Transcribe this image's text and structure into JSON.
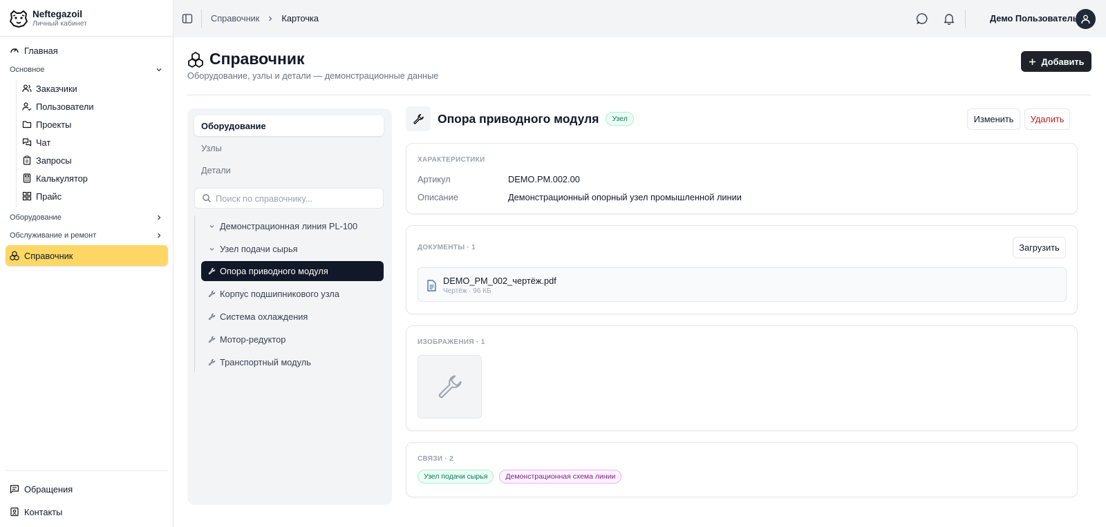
{
  "brand": {
    "name": "Neftegazoil",
    "subtitle": "Личный кабинет"
  },
  "sidebar": {
    "home": "Главная",
    "sections": {
      "main": "Основное",
      "equipment": "Оборудование",
      "service": "Обслуживание и ремонт"
    },
    "sub_items": [
      {
        "label": "Заказчики",
        "icon": "users-icon"
      },
      {
        "label": "Пользователи",
        "icon": "user-check-icon"
      },
      {
        "label": "Проекты",
        "icon": "folder-icon"
      },
      {
        "label": "Чат",
        "icon": "messages-icon"
      },
      {
        "label": "Запросы",
        "icon": "clipboard-icon"
      },
      {
        "label": "Калькулятор",
        "icon": "calculator-icon"
      },
      {
        "label": "Прайс",
        "icon": "grid-icon"
      }
    ],
    "active": "Справочник",
    "bottom": {
      "requests": "Обращения",
      "contacts": "Контакты"
    }
  },
  "header": {
    "breadcrumbs": [
      "Справочник",
      "Карточка"
    ],
    "user_name": "Демо Пользователь"
  },
  "page": {
    "title": "Справочник",
    "subtitle": "Оборудование, узлы и детали — демонстрационные данные",
    "add_label": "Добавить"
  },
  "catalog": {
    "tabs": [
      "Оборудование",
      "Узлы",
      "Детали"
    ],
    "active_tab": "Оборудование",
    "search_placeholder": "Поиск по справочнику...",
    "tree": [
      {
        "label": "Демонстрационная линия PL-100",
        "icon": "chevron-down-icon",
        "active": false
      },
      {
        "label": "Узел подачи сырья",
        "icon": "chevron-down-icon",
        "active": false
      },
      {
        "label": "Опора приводного модуля",
        "icon": "wrench-icon",
        "active": true
      },
      {
        "label": "Корпус подшипникового узла",
        "icon": "wrench-icon",
        "active": false
      },
      {
        "label": "Система охлаждения",
        "icon": "wrench-icon",
        "active": false
      },
      {
        "label": "Мотор-редуктор",
        "icon": "wrench-icon",
        "active": false
      },
      {
        "label": "Транспортный модуль",
        "icon": "wrench-icon",
        "active": false
      }
    ]
  },
  "detail": {
    "title": "Опора приводного модуля",
    "type_badge": "Узел",
    "edit_label": "Изменить",
    "delete_label": "Удалить",
    "characteristics": {
      "label": "ХАРАКТЕРИСТИКИ",
      "article_key": "Артикул",
      "article_value": "DEMO.PM.002.00",
      "description_key": "Описание",
      "description_value": "Демонстрационный опорный узел промышленной линии"
    },
    "documents": {
      "label": "ДОКУМЕНТЫ · 1",
      "upload_label": "Загрузить",
      "files": [
        {
          "name": "DEMO_PM_002_чертёж.pdf",
          "meta": "Чертёж · 96 КБ"
        }
      ]
    },
    "images": {
      "label": "ИЗОБРАЖЕНИЯ · 1"
    },
    "links": {
      "label": "СВЯЗИ · 2",
      "items": [
        "Узел подачи сырья",
        "Демонстрационная схема линии"
      ]
    }
  },
  "colors": {
    "accent_active": "#fcd766",
    "dark": "#111827",
    "danger": "#b91c1c",
    "badge_green": "#047857",
    "badge_purple": "#86198f"
  }
}
